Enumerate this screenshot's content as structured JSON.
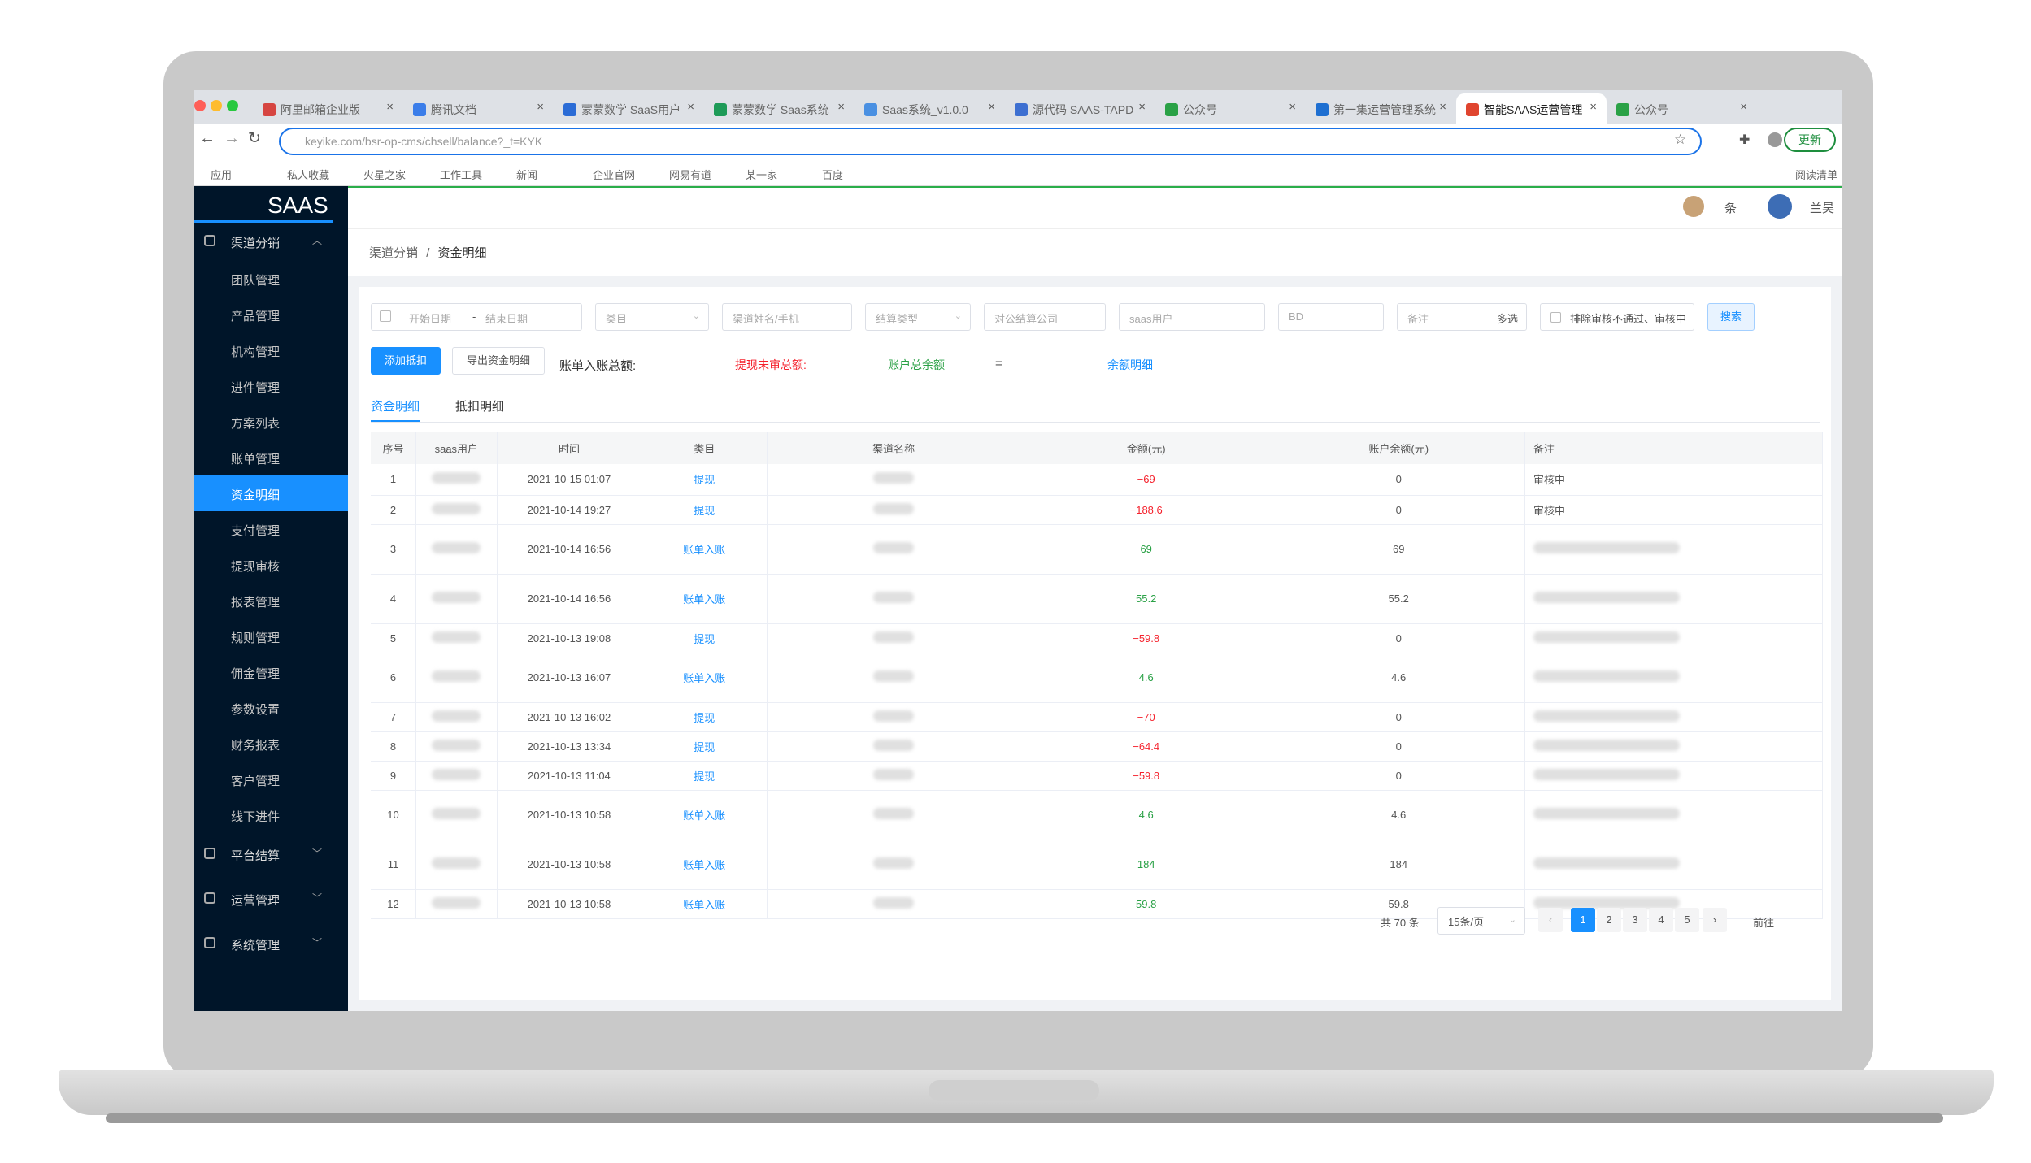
{
  "browser": {
    "tabs": [
      "阿里邮箱企业版",
      "腾讯文档",
      "蒙蒙数学 SaaS用户",
      "蒙蒙数学 Saas系统",
      "Saas系统_v1.0.0",
      "源代码 SAAS-TAPD",
      "公众号",
      "第一集运营管理系统",
      "智能SAAS运营管理",
      "公众号"
    ],
    "url": "keyike.com/bsr-op-cms/chsell/balance?_t=KYK",
    "bookmarks": [
      "应用",
      "私人收藏",
      "火星之家",
      "工作工具",
      "新闻",
      "企业官网",
      "网易有道",
      "某一家",
      "百度"
    ],
    "update_label": "更新",
    "reading_list": "阅读清单"
  },
  "sidebar": {
    "logo": "SAAS",
    "groups": [
      {
        "label": "渠道分销",
        "expanded": true
      },
      {
        "label": "平台结算"
      },
      {
        "label": "运营管理"
      },
      {
        "label": "系统管理"
      }
    ],
    "items": [
      "团队管理",
      "产品管理",
      "机构管理",
      "进件管理",
      "方案列表",
      "账单管理",
      "资金明细",
      "支付管理",
      "提现审核",
      "报表管理",
      "规则管理",
      "佣金管理",
      "参数设置",
      "财务报表",
      "客户管理",
      "线下进件"
    ]
  },
  "topbar": {
    "notice": "条",
    "user": "兰昊"
  },
  "breadcrumb": {
    "root": "渠道分销",
    "sep": "/",
    "current": "资金明细"
  },
  "filters": {
    "start_date": "开始日期",
    "date_sep": "-",
    "end_date": "结束日期",
    "category": "类目",
    "channel": "渠道姓名/手机",
    "settle_type": "结算类型",
    "company": "对公结算公司",
    "saas_user": "saas用户",
    "bd": "BD",
    "remark": "备注",
    "multi": "多选",
    "exclude": "排除审核不通过、审核中",
    "search": "搜索"
  },
  "actions": {
    "add": "添加抵扣",
    "export": "导出资金明细"
  },
  "summary": {
    "income_label": "账单入账总额:",
    "pending_label": "提现未审总额:",
    "balance_label": "账户总余额",
    "eq": "=",
    "detail_link": "余额明细"
  },
  "subtabs": [
    "资金明细",
    "抵扣明细"
  ],
  "table": {
    "headers": [
      "序号",
      "saas用户",
      "时间",
      "类目",
      "渠道名称",
      "金额(元)",
      "账户余额(元)",
      "备注"
    ],
    "rows": [
      {
        "no": "1",
        "time": "2021-10-15 01:07",
        "cat": "提现",
        "amount": "−69",
        "balance": "0",
        "remark": "审核中",
        "neg": true
      },
      {
        "no": "2",
        "time": "2021-10-14 19:27",
        "cat": "提现",
        "amount": "−188.6",
        "balance": "0",
        "remark": "审核中",
        "neg": true
      },
      {
        "no": "3",
        "time": "2021-10-14 16:56",
        "cat": "账单入账",
        "amount": "69",
        "balance": "69",
        "remark": "",
        "neg": false
      },
      {
        "no": "4",
        "time": "2021-10-14 16:56",
        "cat": "账单入账",
        "amount": "55.2",
        "balance": "55.2",
        "remark": "",
        "neg": false
      },
      {
        "no": "5",
        "time": "2021-10-13 19:08",
        "cat": "提现",
        "amount": "−59.8",
        "balance": "0",
        "remark": "",
        "neg": true
      },
      {
        "no": "6",
        "time": "2021-10-13 16:07",
        "cat": "账单入账",
        "amount": "4.6",
        "balance": "4.6",
        "remark": "",
        "neg": false
      },
      {
        "no": "7",
        "time": "2021-10-13 16:02",
        "cat": "提现",
        "amount": "−70",
        "balance": "0",
        "remark": "",
        "neg": true
      },
      {
        "no": "8",
        "time": "2021-10-13 13:34",
        "cat": "提现",
        "amount": "−64.4",
        "balance": "0",
        "remark": "",
        "neg": true
      },
      {
        "no": "9",
        "time": "2021-10-13 11:04",
        "cat": "提现",
        "amount": "−59.8",
        "balance": "0",
        "remark": "",
        "neg": true
      },
      {
        "no": "10",
        "time": "2021-10-13 10:58",
        "cat": "账单入账",
        "amount": "4.6",
        "balance": "4.6",
        "remark": "",
        "neg": false
      },
      {
        "no": "11",
        "time": "2021-10-13 10:58",
        "cat": "账单入账",
        "amount": "184",
        "balance": "184",
        "remark": "",
        "neg": false
      },
      {
        "no": "12",
        "time": "2021-10-13 10:58",
        "cat": "账单入账",
        "amount": "59.8",
        "balance": "59.8",
        "remark": "",
        "neg": false
      }
    ]
  },
  "pagination": {
    "total": "共 70 条",
    "size": "15条/页",
    "pages": [
      "1",
      "2",
      "3",
      "4",
      "5"
    ],
    "goto": "前往"
  },
  "colors": {
    "accent": "#1890ff",
    "sidebar": "#001529",
    "negative": "#f5222d",
    "positive": "#2aa146"
  }
}
